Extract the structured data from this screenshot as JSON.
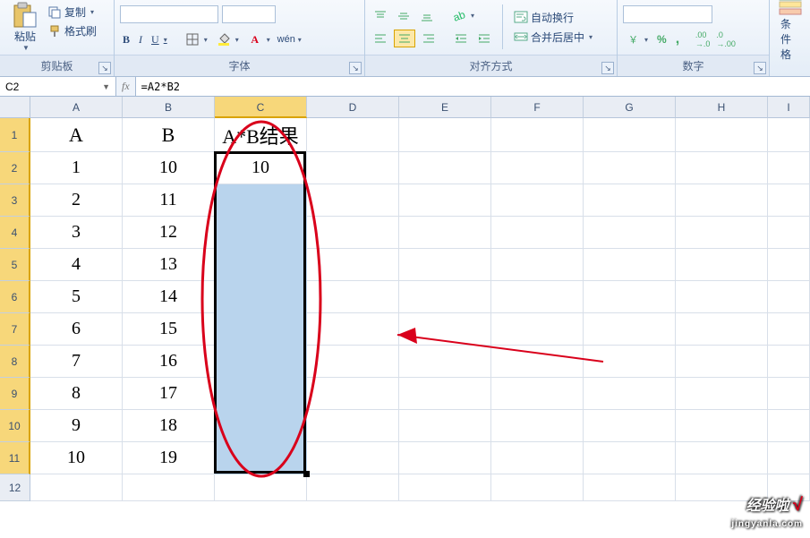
{
  "ribbon": {
    "clipboard": {
      "paste": "粘贴",
      "copy": "复制",
      "format_painter": "格式刷",
      "label": "剪贴板"
    },
    "font": {
      "bold": "B",
      "italic": "I",
      "underline": "U",
      "label": "字体"
    },
    "alignment": {
      "merge_center": "合并后居中",
      "wrap_text": "自动换行",
      "label": "对齐方式"
    },
    "number": {
      "percent": "%",
      "comma": ",",
      "label": "数字"
    },
    "styles": {
      "conditional": "条件格",
      "label": ""
    }
  },
  "formula_bar": {
    "name_box": "C2",
    "fx": "fx",
    "formula": "=A2*B2"
  },
  "grid": {
    "col_widths": {
      "A": 103,
      "B": 103,
      "C": 103,
      "D": 103,
      "E": 103,
      "F": 103,
      "G": 103,
      "H": 103,
      "I": 47
    },
    "row_heights": [],
    "columns": [
      "A",
      "B",
      "C",
      "D",
      "E",
      "F",
      "G",
      "H",
      "I"
    ],
    "header_row_h": 38,
    "data_row_h": 36,
    "last_row_h": 30,
    "data": {
      "A1": "A",
      "B1": "B",
      "C1": "A*B结果",
      "A2": "1",
      "B2": "10",
      "C2": "10",
      "A3": "2",
      "B3": "11",
      "A4": "3",
      "B4": "12",
      "A5": "4",
      "B5": "13",
      "A6": "5",
      "B6": "14",
      "A7": "6",
      "B7": "15",
      "A8": "7",
      "B8": "16",
      "A9": "8",
      "B9": "17",
      "A10": "9",
      "B10": "18",
      "A11": "10",
      "B11": "19"
    },
    "selected_rows": [
      1,
      2,
      3,
      4,
      5,
      6,
      7,
      8,
      9,
      10,
      11
    ],
    "selected_col": "C"
  },
  "watermark": {
    "line1": "经验啦",
    "check": "√",
    "line2": "jingyanla.com"
  }
}
